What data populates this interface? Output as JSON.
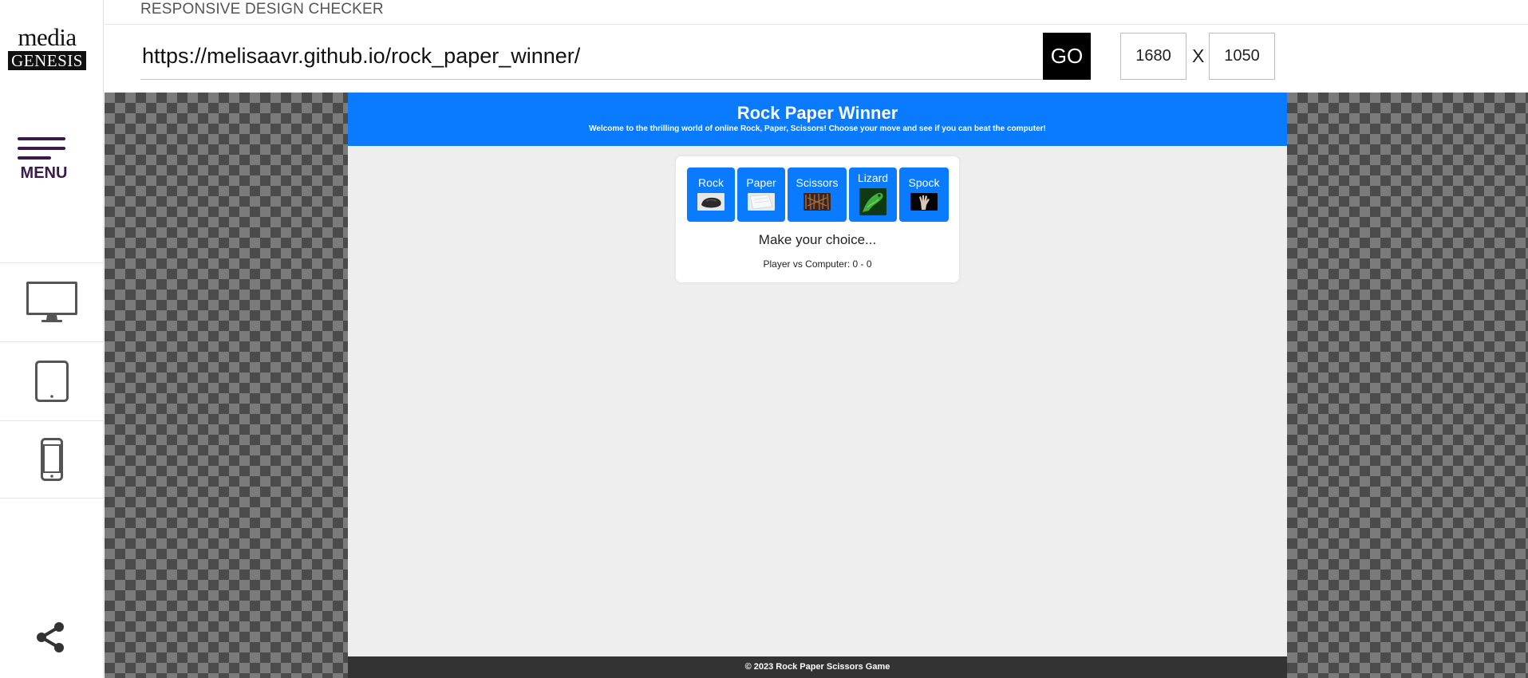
{
  "app": {
    "title": "RESPONSIVE DESIGN CHECKER"
  },
  "logo": {
    "line1": "media",
    "line2": "GENESIS"
  },
  "sidebar": {
    "menu_label": "MENU",
    "devices": [
      {
        "name": "desktop",
        "icon": "desktop-icon"
      },
      {
        "name": "tablet",
        "icon": "tablet-icon"
      },
      {
        "name": "phone",
        "icon": "phone-icon"
      }
    ],
    "share_icon": "share-icon"
  },
  "toolbar": {
    "url": "https://melisaavr.github.io/rock_paper_winner/",
    "go_label": "GO",
    "width": "1680",
    "separator": "X",
    "height": "1050"
  },
  "game": {
    "header_title": "Rock Paper Winner",
    "header_subtitle": "Welcome to the thrilling world of online Rock, Paper, Scissors! Choose your move and see if you can beat the computer!",
    "choices": [
      {
        "label": "Rock"
      },
      {
        "label": "Paper"
      },
      {
        "label": "Scissors"
      },
      {
        "label": "Lizard"
      },
      {
        "label": "Spock"
      }
    ],
    "status": "Make your choice...",
    "score": "Player vs Computer: 0 - 0",
    "footer": "© 2023 Rock Paper Scissors Game"
  },
  "colors": {
    "accent": "#0a7bff",
    "menu": "#3a1a49",
    "footer": "#333333",
    "checker_dark": "#4b4b4b",
    "checker_light": "#7b7b7b"
  }
}
